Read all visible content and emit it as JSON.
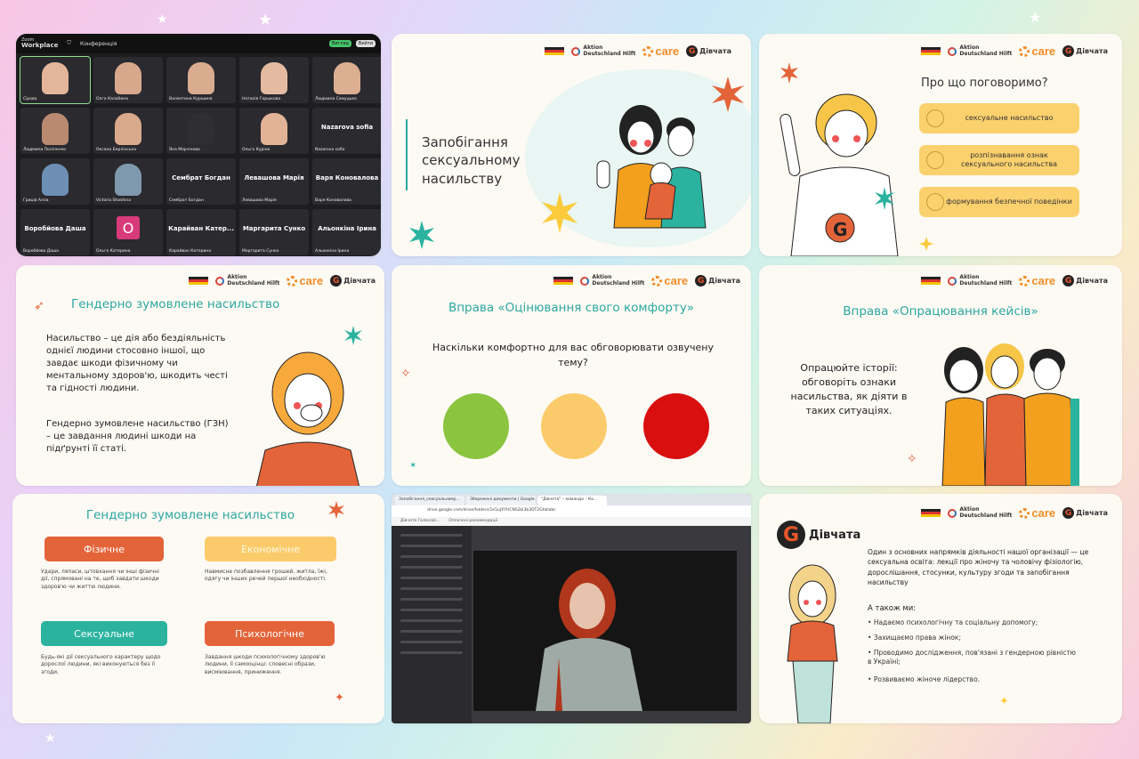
{
  "zoom": {
    "brand_line1": "Zoom",
    "brand_line2": "Workplace",
    "meeting_label": "Конференція",
    "btn_view": "Вигляд",
    "btn_leave": "Вийти",
    "participants": [
      {
        "name": "Сірова",
        "center": "",
        "skin": "#e3b59a"
      },
      {
        "name": "Олга Калабина",
        "center": "",
        "skin": "#d8a88c"
      },
      {
        "name": "Валентина Куршина",
        "center": "",
        "skin": "#d9ab8f"
      },
      {
        "name": "Наталія Горшкова",
        "center": "",
        "skin": "#e4bba0"
      },
      {
        "name": "Людмила Самуцько",
        "center": "",
        "skin": "#dcae92"
      },
      {
        "name": "Людмила Поліпенко",
        "center": "",
        "skin": "#b98a70"
      },
      {
        "name": "Оксана Берлінська",
        "center": "",
        "skin": "#d9a98c"
      },
      {
        "name": "Яна Марчінова",
        "center": "",
        "skin": "#2f2f33"
      },
      {
        "name": "Ольга Куріна",
        "center": "",
        "skin": "#e2b396"
      },
      {
        "name": "Nazarova sofia",
        "center": "Nazarova sofia",
        "skin": ""
      },
      {
        "name": "Гриців Алла",
        "center": "",
        "skin": "#6d8fb5"
      },
      {
        "name": "Victoria Shashina",
        "center": "",
        "skin": "#7f98ad"
      },
      {
        "name": "Сембрат Богдан",
        "center": "Сембрат Богдан",
        "skin": ""
      },
      {
        "name": "Левашова Марія",
        "center": "Левашова Марія",
        "skin": ""
      },
      {
        "name": "Варя Коновалова",
        "center": "Варя Коновалова",
        "skin": ""
      },
      {
        "name": "Воробйова Даша",
        "center": "Воробйова Даша",
        "skin": ""
      },
      {
        "name": "Ольга Катерина",
        "center": "",
        "skin": ""
      },
      {
        "name": "Карайван Катерина",
        "center": "Карайван Катер...",
        "skin": ""
      },
      {
        "name": "Маргарита Сунко",
        "center": "Маргарита Сунко",
        "skin": ""
      },
      {
        "name": "Альонкіна Ірина",
        "center": "Альонкіна Ірина",
        "skin": ""
      }
    ],
    "o_badge": "O"
  },
  "logos": {
    "adh_line1": "Aktion",
    "adh_line2": "Deutschland Hilft",
    "care": "care",
    "divchata": "Дівчата",
    "g_letter": "G"
  },
  "slide_title": {
    "title": "Запобігання сексуальному насильству"
  },
  "slide_topics": {
    "heading": "Про що поговоримо?",
    "items": [
      "сексуальне насильство",
      "розпізнавання ознак сексуального насильства",
      "формування безпечної поведінки"
    ],
    "shirt_letter": "G"
  },
  "slide_gbv": {
    "title": "Гендерно зумовлене насильство",
    "para1": "Насильство – це дія або бездіяльність однієї людини стосовно іншої, що завдає шкоди фізичному чи ментальному здоров'ю, шкодить честі та гідності людини.",
    "para2": "Гендерно зумовлене насильство (ГЗН) – це завдання людині шкоди на підґрунті її статі."
  },
  "slide_comfort": {
    "title": "Вправа «Оцінювання свого комфорту»",
    "question": "Наскільки комфортно для вас обговорювати озвучену тему?",
    "circles": [
      "#8bc43f",
      "#fbcb6b",
      "#d90f0f"
    ]
  },
  "slide_cases": {
    "title": "Вправа «Опрацювання кейсів»",
    "text": "Опрацюйте історії: обговоріть ознаки насильства, як діяти в таких ситуаціях."
  },
  "slide_types": {
    "title": "Гендерно зумовлене насильство",
    "types": [
      {
        "label": "Фізичне",
        "color": "#e4643a",
        "desc": "Удари, ляпаси, штовхання чи інші фізичні дії, спрямовані на те, щоб завдати шкоди здоров'ю чи життю людини."
      },
      {
        "label": "Економічне",
        "color": "#fbcb6b",
        "desc": "Навмисне позбавлення грошей, житла, їжі, одягу чи інших речей першої необхідності."
      },
      {
        "label": "Сексуальне",
        "color": "#2bb3a0",
        "desc": "Будь-які дії сексуального характеру щодо дорослої людини, які виконуються без її згоди."
      },
      {
        "label": "Психологічне",
        "color": "#e4643a",
        "desc": "Завдання шкоди психологічному здоров'ю людини, її самооцінці: словесні образи, висміювання, приниження."
      }
    ]
  },
  "browser": {
    "tabs": [
      "Запобігання_сексуальному...",
      "Збережені документи | Google...",
      "\"Дівчата\" – команда – Ко..."
    ],
    "url": "drive.google.com/drive/folders/1e5uJXYHCNS2kI3b3DT2Ghblabc",
    "bookmarks": [
      "Дівчата Голосові...",
      "Оплачені рекомендації"
    ]
  },
  "slide_about": {
    "brand": "Дівчата",
    "g_letter": "G",
    "intro": "Один з основних напрямків діяльності нашої організації — це сексуальна освіта: лекції про жіночу та чоловічу фізіологію, дорослішання, стосунки, культуру згоди та запобігання насильству",
    "also": "А також ми:",
    "bullets": [
      "Надаємо психологічну та соціальну допомогу;",
      "Захищаємо права жінок;",
      "Проводимо дослідження, пов'язані з гендерною рівністю в Україні;",
      "Розвиваємо жіноче лідерство."
    ]
  }
}
